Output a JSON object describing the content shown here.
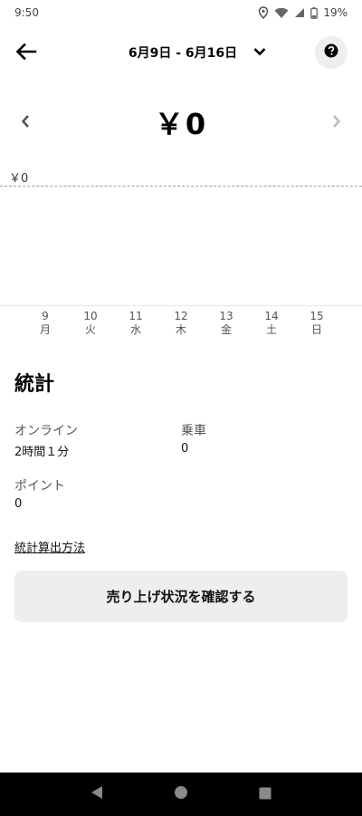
{
  "status_bar": {
    "time": "9:50",
    "battery": "19%",
    "icons": [
      "location-icon",
      "wifi-icon",
      "signal-icon",
      "battery-icon"
    ]
  },
  "header": {
    "date_range": "6月9日 - 6月16日",
    "back_icon": "arrow-left-icon",
    "dropdown_icon": "chevron-down-icon",
    "help_icon": "question-circle-icon"
  },
  "summary": {
    "amount": "￥0",
    "prev_icon": "chevron-left-icon",
    "next_icon": "chevron-right-icon"
  },
  "chart": {
    "y_label": "￥0",
    "days": [
      {
        "num": "9",
        "dow": "月"
      },
      {
        "num": "10",
        "dow": "火"
      },
      {
        "num": "11",
        "dow": "水"
      },
      {
        "num": "12",
        "dow": "木"
      },
      {
        "num": "13",
        "dow": "金"
      },
      {
        "num": "14",
        "dow": "土"
      },
      {
        "num": "15",
        "dow": "日"
      }
    ]
  },
  "stats": {
    "title": "統計",
    "online_label": "オンライン",
    "online_value": "2時間１分",
    "rides_label": "乗車",
    "rides_value": "0",
    "points_label": "ポイント",
    "points_value": "0",
    "method_link": "統計算出方法"
  },
  "cta": {
    "label": "売り上げ状況を確認する"
  },
  "nav": {
    "back_icon": "nav-back-icon",
    "home_icon": "nav-home-icon",
    "recents_icon": "nav-recents-icon"
  },
  "colors": {
    "accent": "#000000",
    "surface": "#eeeeee",
    "muted_text": "#555555",
    "dash": "#9e9e9e",
    "nav_bar": "#000000"
  }
}
